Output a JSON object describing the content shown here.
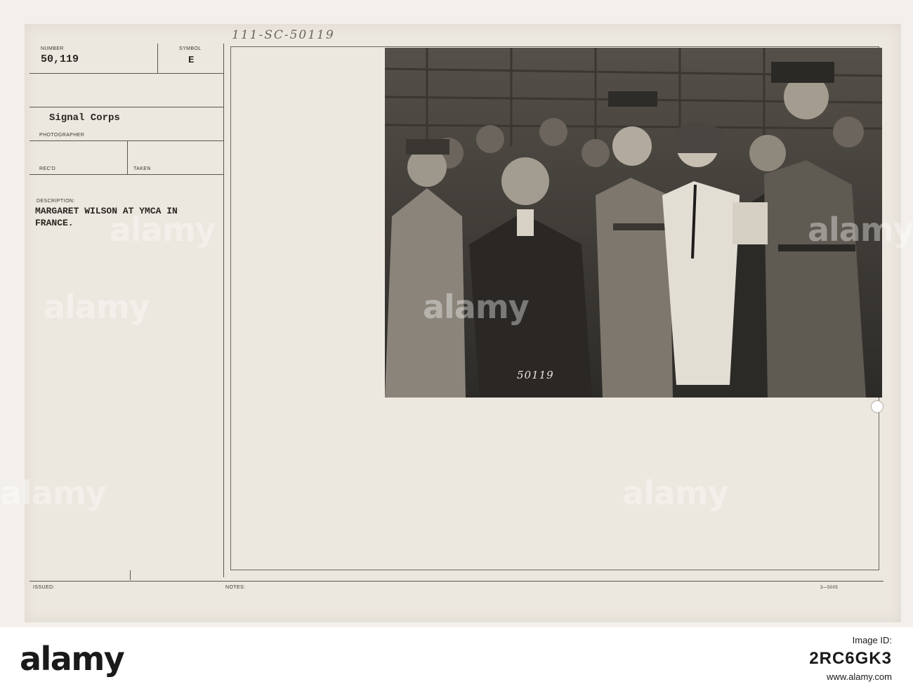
{
  "card": {
    "handwritten_ref": "111-SC-50119",
    "number_label": "NUMBER",
    "number_value": "50,119",
    "symbol_label": "SYMBOL",
    "symbol_value": "E",
    "photographer_value": "Signal Corps",
    "photographer_label": "PHOTOGRAPHER",
    "recd_label": "REC'D",
    "taken_label": "TAKEN",
    "description_label": "DESCRIPTION:",
    "description_line1": "MARGARET WILSON AT YMCA IN",
    "description_line2": "FRANCE.",
    "issued_label": "ISSUED:",
    "notes_label": "NOTES:",
    "form_code": "3—5005"
  },
  "photo": {
    "negative_number": "50119"
  },
  "watermark": {
    "text": "alamy"
  },
  "footer": {
    "brand": "alamy",
    "image_id_label": "Image ID:",
    "image_id": "2RC6GK3",
    "url": "www.alamy.com"
  },
  "colors": {
    "card": "#ece7df",
    "ink": "#2a2622",
    "photo_dark": "#3b3935"
  }
}
